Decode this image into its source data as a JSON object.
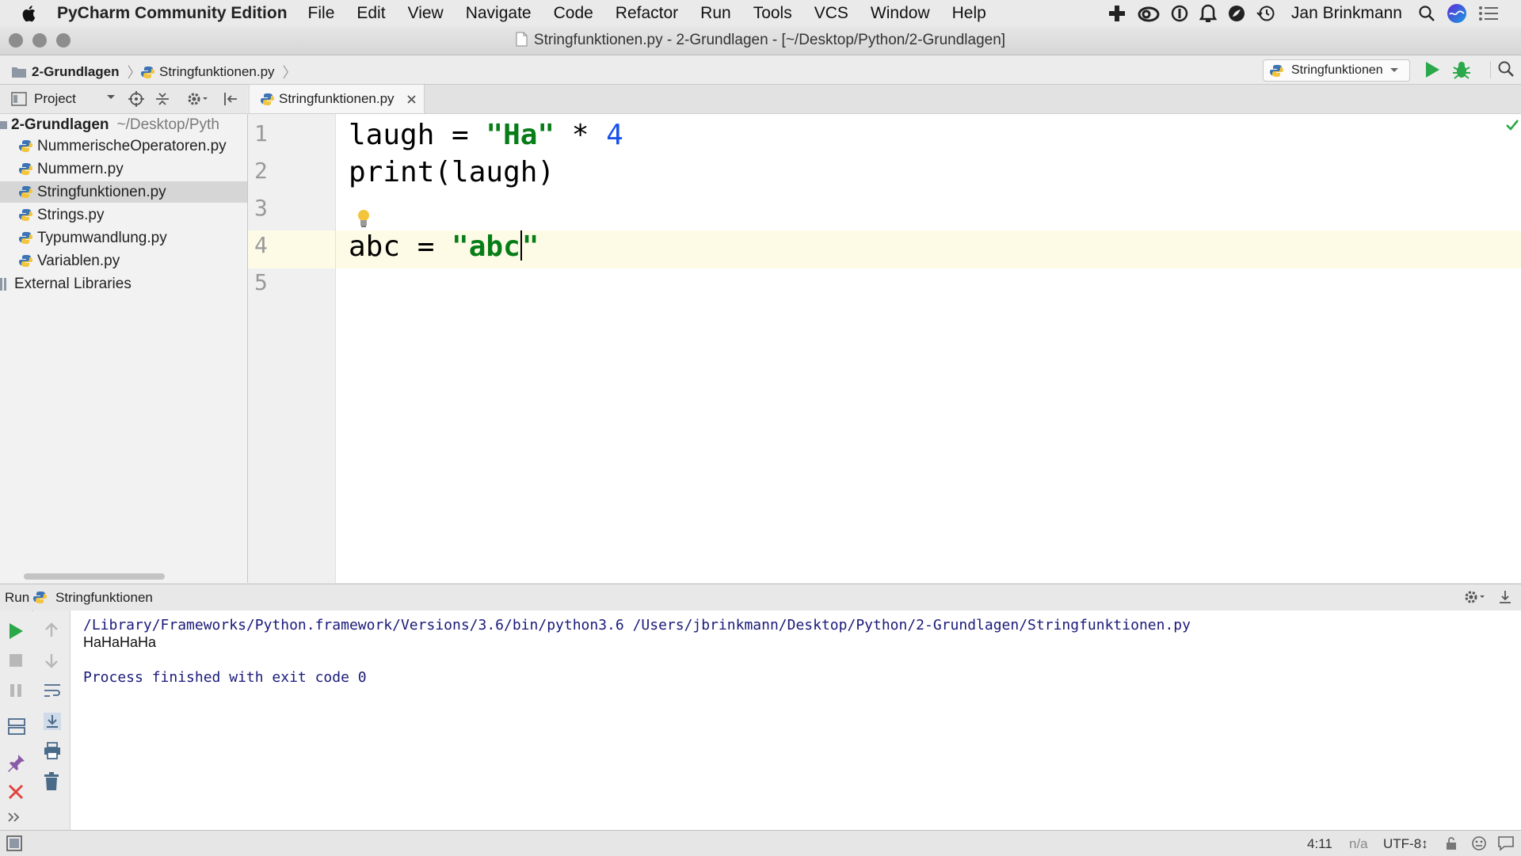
{
  "menubar": {
    "app_name": "PyCharm Community Edition",
    "items": [
      "File",
      "Edit",
      "View",
      "Navigate",
      "Code",
      "Refactor",
      "Run",
      "Tools",
      "VCS",
      "Window",
      "Help"
    ],
    "user": "Jan Brinkmann"
  },
  "window": {
    "title": "Stringfunktionen.py - 2-Grundlagen - [~/Desktop/Python/2-Grundlagen]"
  },
  "navbar": {
    "breadcrumb_project": "2-Grundlagen",
    "breadcrumb_file": "Stringfunktionen.py",
    "run_config": "Stringfunktionen"
  },
  "project_panel": {
    "header": "Project",
    "root_name": "2-Grundlagen",
    "root_path": "~/Desktop/Pyth",
    "files": [
      "NummerischeOperatoren.py",
      "Nummern.py",
      "Stringfunktionen.py",
      "Strings.py",
      "Typumwandlung.py",
      "Variablen.py"
    ],
    "selected_file": "Stringfunktionen.py",
    "external": "External Libraries"
  },
  "editor": {
    "tab_label": "Stringfunktionen.py",
    "line_numbers": [
      "1",
      "2",
      "3",
      "4",
      "5"
    ],
    "line1": {
      "a": "laugh = ",
      "str": "\"Ha\"",
      "b": " * ",
      "num": "4"
    },
    "line2": "print(laugh)",
    "line4": {
      "a": "abc = ",
      "str_open": "\"abc",
      "str_close": "\""
    },
    "cursor_line": 4
  },
  "run_panel": {
    "label": "Run",
    "config": "Stringfunktionen",
    "command": "/Library/Frameworks/Python.framework/Versions/3.6/bin/python3.6 /Users/jbrinkmann/Desktop/Python/2-Grundlagen/Stringfunktionen.py",
    "output": "HaHaHaHa",
    "exit_message": "Process finished with exit code 0"
  },
  "statusbar": {
    "position": "4:11",
    "na": "n/a",
    "encoding": "UTF-8↕"
  },
  "colors": {
    "string": "#067d17",
    "number": "#1750eb",
    "console_text": "#1a1a7a",
    "run_green": "#2aa84a",
    "stop_red": "#e0443e"
  }
}
